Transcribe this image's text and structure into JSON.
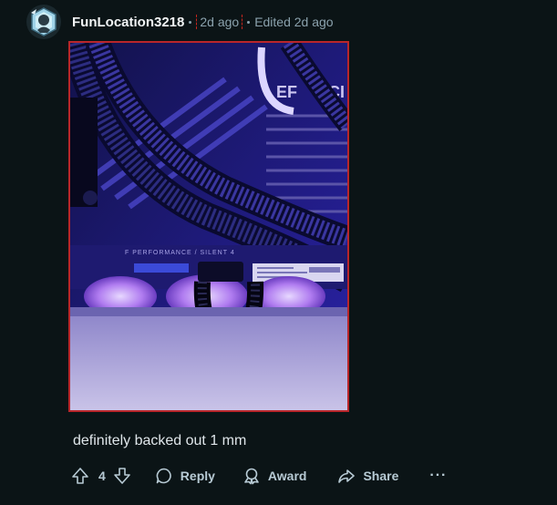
{
  "comment": {
    "author": "FunLocation3218",
    "posted_ago": "2d ago",
    "edited_label": "Edited 2d ago",
    "body": "definitely backed out 1 mm",
    "image": {
      "icon": "photo-pc-internals",
      "printed_text": [
        "F PERFORMANCE / SILENT 4",
        "EF",
        "CI"
      ]
    },
    "vote_score": "4",
    "reply_label": "Reply",
    "award_label": "Award",
    "share_label": "Share",
    "more_label": "···"
  },
  "colors": {
    "background": "#0b1416",
    "username": "#f2f4f5",
    "meta": "#8ba2ad",
    "highlight_border": "#b9262a"
  },
  "icons": {
    "avatar": "avatar-icon",
    "upvote": "upvote-icon",
    "downvote": "downvote-icon",
    "reply": "comment-bubble-icon",
    "award": "award-icon",
    "share": "share-icon"
  }
}
